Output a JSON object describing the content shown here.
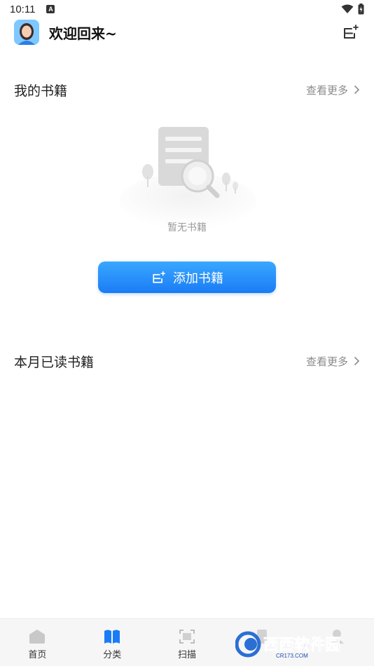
{
  "status": {
    "time": "10:11"
  },
  "header": {
    "title": "欢迎回来~"
  },
  "my_books": {
    "title": "我的书籍",
    "more": "查看更多",
    "empty_text": "暂无书籍",
    "add_button": "添加书籍"
  },
  "monthly": {
    "title": "本月已读书籍",
    "more": "查看更多"
  },
  "tabs": [
    {
      "label": "首页",
      "icon": "home-icon"
    },
    {
      "label": "分类",
      "icon": "book-icon"
    },
    {
      "label": "扫描",
      "icon": "scan-icon"
    },
    {
      "label": "",
      "icon": "file-icon"
    },
    {
      "label": "",
      "icon": "user-icon"
    }
  ],
  "watermark": {
    "text": "西西软件园",
    "sub": "CR173.COM"
  },
  "colors": {
    "accent": "#1a7cf5",
    "muted": "#8a8a8a"
  }
}
